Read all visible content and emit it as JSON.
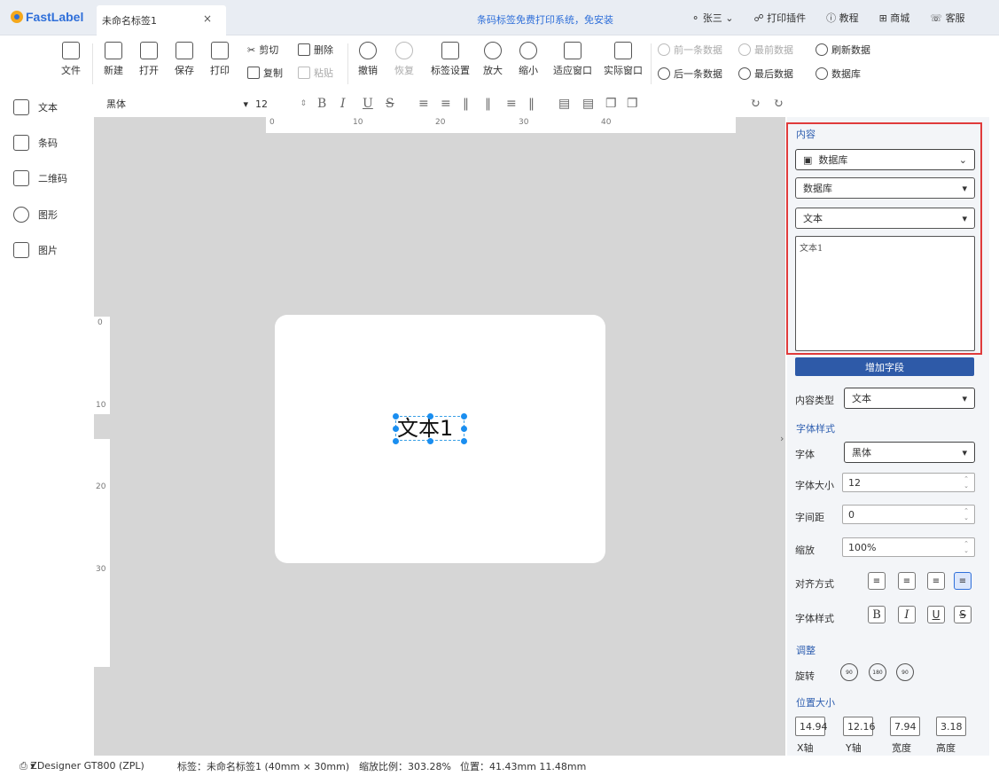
{
  "brand": {
    "name": "FastLabel"
  },
  "tab": {
    "title": "未命名标签1",
    "close": "×"
  },
  "promo": "条码标签免费打印系统，免安装",
  "topLinks": [
    "张三",
    "打印插件",
    "教程",
    "商城",
    "客服"
  ],
  "toolbar": {
    "file": "文件",
    "new": "新建",
    "open": "打开",
    "save": "保存",
    "print": "打印",
    "cut": "剪切",
    "copy": "复制",
    "delete": "删除",
    "paste": "粘贴",
    "undo": "撤销",
    "redo": "恢复",
    "labelSettings": "标签设置",
    "zoomIn": "放大",
    "zoomOut": "缩小",
    "fitWindow": "适应窗口",
    "actualWindow": "实际窗口",
    "prevRecord": "前一条数据",
    "firstRecord": "最前数据",
    "refresh": "刷新数据",
    "nextRecord": "后一条数据",
    "lastRecord": "最后数据",
    "database": "数据库"
  },
  "sidebar": {
    "items": [
      {
        "label": "文本",
        "icon": "text-icon"
      },
      {
        "label": "条码",
        "icon": "barcode-icon"
      },
      {
        "label": "二维码",
        "icon": "qrcode-icon"
      },
      {
        "label": "图形",
        "icon": "shape-icon"
      },
      {
        "label": "图片",
        "icon": "image-icon"
      }
    ]
  },
  "format": {
    "font": "黑体",
    "size": "12"
  },
  "ruler": {
    "top": [
      "0",
      "10",
      "20",
      "30",
      "40"
    ],
    "left": [
      "0",
      "10",
      "20",
      "30"
    ]
  },
  "canvas": {
    "text": "文本1"
  },
  "panel": {
    "contentTitle": "内容",
    "source": "数据库",
    "dbSelect": "数据库",
    "fieldSelect": "文本",
    "textValue": "文本1",
    "addField": "增加字段",
    "contentTypeLabel": "内容类型",
    "contentType": "文本",
    "fontStyleTitle": "字体样式",
    "fontLabel": "字体",
    "fontValue": "黑体",
    "fontSizeLabel": "字体大小",
    "fontSizeValue": "12",
    "spacingLabel": "字间距",
    "spacingValue": "0",
    "scaleLabel": "缩放",
    "scaleValue": "100%",
    "alignLabel": "对齐方式",
    "styleLabel": "字体样式",
    "adjustTitle": "调整",
    "rotateLabel": "旋转",
    "positionTitle": "位置大小",
    "x": "14.94",
    "y": "12.16",
    "w": "7.94",
    "h": "3.18",
    "xLabel": "X轴",
    "yLabel": "Y轴",
    "wLabel": "宽度",
    "hLabel": "高度"
  },
  "status": {
    "printer": "ZDesigner GT800 (ZPL)",
    "label": "标签：未命名标签1 (40mm × 30mm)",
    "zoom": "缩放比例：303.28%",
    "position": "位置：41.43mm 11.48mm"
  }
}
